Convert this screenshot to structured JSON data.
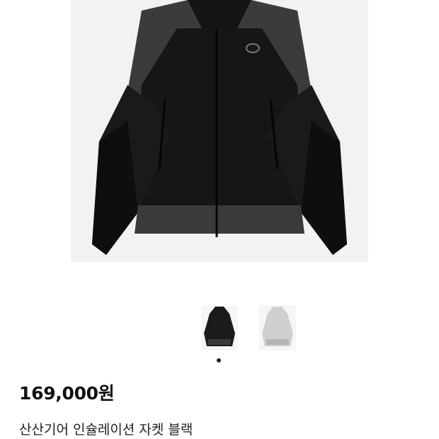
{
  "product": {
    "price": "169,000원",
    "title": "산산기어 인슐레이션 자켓 블랙"
  },
  "gallery": {
    "active_index": 0,
    "thumbnails": [
      {
        "name": "thumbnail-black-jacket",
        "color": "#1b1b1b"
      },
      {
        "name": "thumbnail-grey-jacket",
        "color": "#cfcfcf"
      }
    ]
  },
  "colors": {
    "jacket_main": "#161616",
    "jacket_panel": "#3a3a3a",
    "background": "#f2f2f2"
  }
}
